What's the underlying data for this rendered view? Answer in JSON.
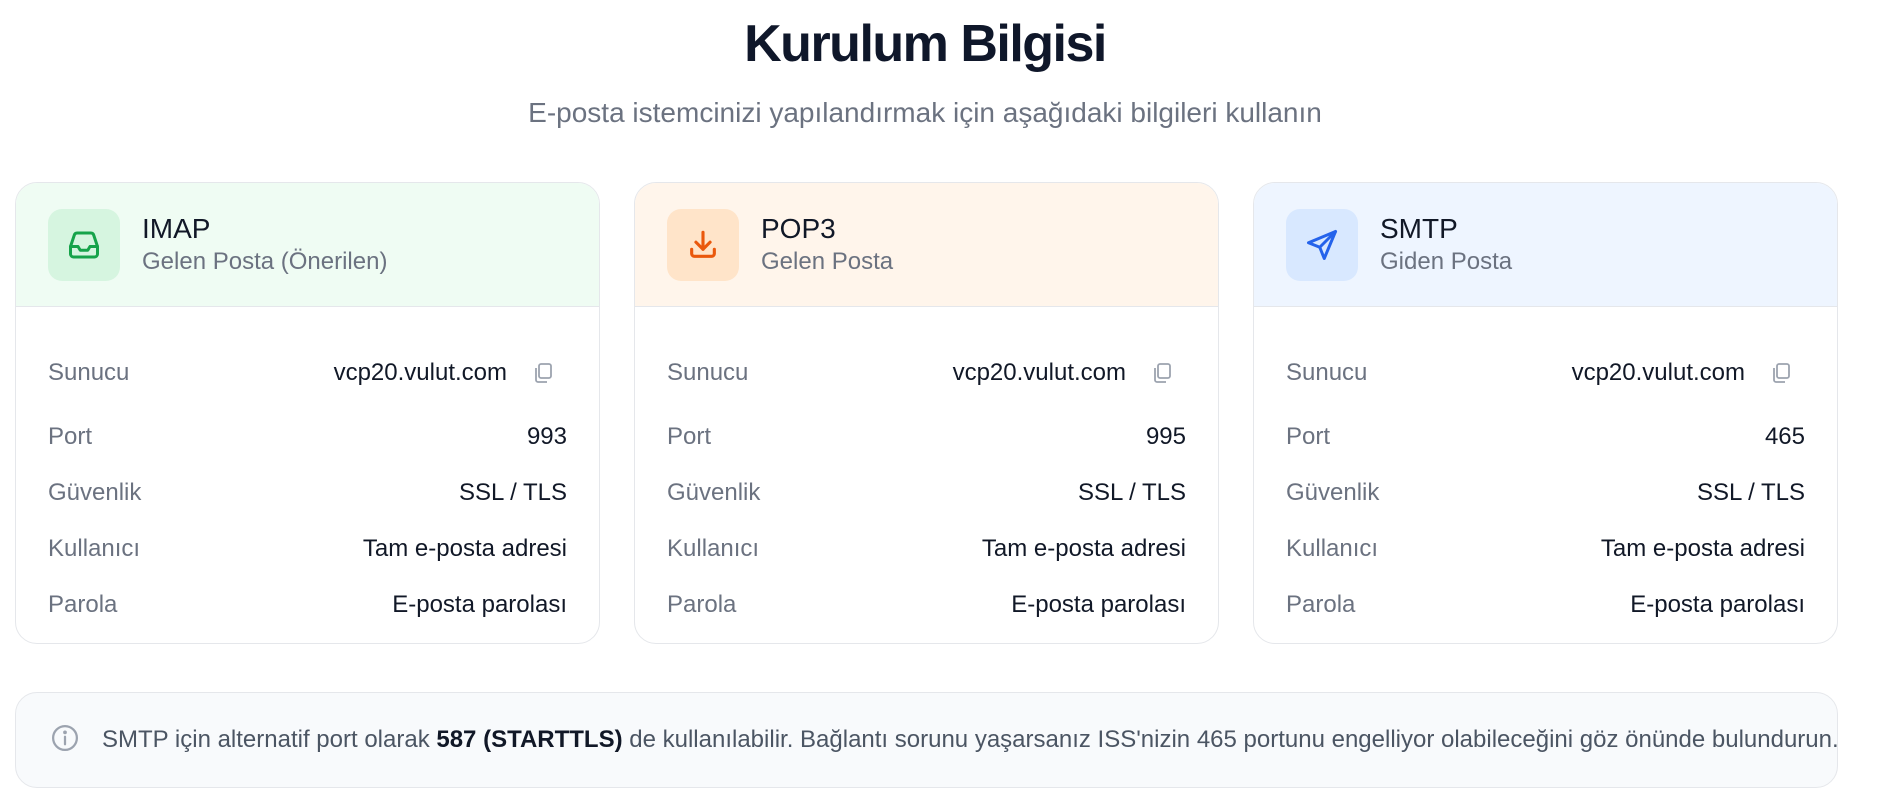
{
  "header": {
    "title": "Kurulum Bilgisi",
    "subtitle": "E-posta istemcinizi yapılandırmak için aşağıdaki bilgileri kullanın"
  },
  "labels": {
    "server": "Sunucu",
    "port": "Port",
    "security": "Güvenlik",
    "user": "Kullanıcı",
    "password": "Parola"
  },
  "cards": [
    {
      "protocol": "IMAP",
      "description": "Gelen Posta (Önerilen)",
      "icon": "inbox-icon",
      "accent": "#16a34a",
      "server": "vcp20.vulut.com",
      "port": "993",
      "security": "SSL / TLS",
      "user": "Tam e-posta adresi",
      "password": "E-posta parolası"
    },
    {
      "protocol": "POP3",
      "description": "Gelen Posta",
      "icon": "download-icon",
      "accent": "#ea580c",
      "server": "vcp20.vulut.com",
      "port": "995",
      "security": "SSL / TLS",
      "user": "Tam e-posta adresi",
      "password": "E-posta parolası"
    },
    {
      "protocol": "SMTP",
      "description": "Giden Posta",
      "icon": "send-icon",
      "accent": "#2563eb",
      "server": "vcp20.vulut.com",
      "port": "465",
      "security": "SSL / TLS",
      "user": "Tam e-posta adresi",
      "password": "E-posta parolası"
    }
  ],
  "note": {
    "prefix": "SMTP için alternatif port olarak ",
    "highlight": "587 (STARTTLS)",
    "suffix": " de kullanılabilir. Bağlantı sorunu yaşarsanız ISS'nizin 465 portunu engelliyor olabileceğini göz önünde bulundurun."
  }
}
